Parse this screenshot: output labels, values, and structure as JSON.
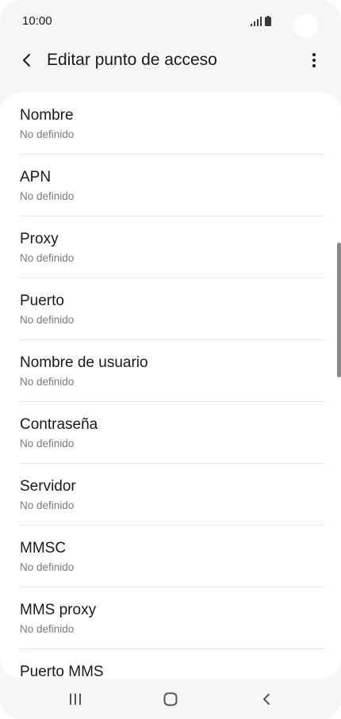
{
  "status_bar": {
    "time": "10:00",
    "icons": [
      "signal-icon",
      "battery-icon"
    ]
  },
  "app_bar": {
    "title": "Editar punto de acceso",
    "back_icon": "back-arrow-icon",
    "more_icon": "more-vert-icon"
  },
  "fields": [
    {
      "title": "Nombre",
      "value": "No definido"
    },
    {
      "title": "APN",
      "value": "No definido"
    },
    {
      "title": "Proxy",
      "value": "No definido"
    },
    {
      "title": "Puerto",
      "value": "No definido"
    },
    {
      "title": "Nombre de usuario",
      "value": "No definido"
    },
    {
      "title": "Contraseña",
      "value": "No definido"
    },
    {
      "title": "Servidor",
      "value": "No definido"
    },
    {
      "title": "MMSC",
      "value": "No definido"
    },
    {
      "title": "MMS proxy",
      "value": "No definido"
    },
    {
      "title": "Puerto MMS"
    }
  ],
  "nav_bar": {
    "buttons": [
      "recents-icon",
      "home-icon",
      "back-icon"
    ]
  },
  "colors": {
    "background": "#f6f6f6",
    "card": "#ffffff",
    "text_primary": "#1a1a1a",
    "text_secondary": "#7a7a7a"
  }
}
